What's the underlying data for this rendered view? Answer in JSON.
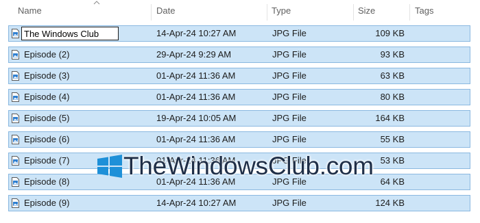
{
  "columns": {
    "name": "Name",
    "date": "Date",
    "type": "Type",
    "size": "Size",
    "tags": "Tags"
  },
  "sort": {
    "column": "name",
    "direction": "ascending",
    "icon": "chevron-up-icon"
  },
  "rename_value": "The Windows Club",
  "files": [
    {
      "name": "The Windows Club",
      "date": "14-Apr-24 10:27 AM",
      "type": "JPG File",
      "size": "109 KB"
    },
    {
      "name": "Episode (2)",
      "date": "29-Apr-24 9:29 AM",
      "type": "JPG File",
      "size": "93 KB"
    },
    {
      "name": "Episode (3)",
      "date": "01-Apr-24 11:36 AM",
      "type": "JPG File",
      "size": "63 KB"
    },
    {
      "name": "Episode (4)",
      "date": "01-Apr-24 11:36 AM",
      "type": "JPG File",
      "size": "80 KB"
    },
    {
      "name": "Episode (5)",
      "date": "19-Apr-24 10:05 AM",
      "type": "JPG File",
      "size": "164 KB"
    },
    {
      "name": "Episode (6)",
      "date": "01-Apr-24 11:36 AM",
      "type": "JPG File",
      "size": "55 KB"
    },
    {
      "name": "Episode (7)",
      "date": "01-Apr-24 11:36 AM",
      "type": "JPG File",
      "size": "53 KB"
    },
    {
      "name": "Episode (8)",
      "date": "01-Apr-24 11:36 AM",
      "type": "JPG File",
      "size": "64 KB"
    },
    {
      "name": "Episode (9)",
      "date": "14-Apr-24 10:27 AM",
      "type": "JPG File",
      "size": "124 KB"
    }
  ],
  "watermark": {
    "text": "TheWindowsClub.com",
    "icon": "windows-logo-icon"
  },
  "colors": {
    "selection_fill": "#cce4f7",
    "selection_border": "#8ab8e0",
    "header_text": "#606060",
    "watermark_text": "#1f2f48",
    "watermark_logo": "#1e90d8"
  }
}
